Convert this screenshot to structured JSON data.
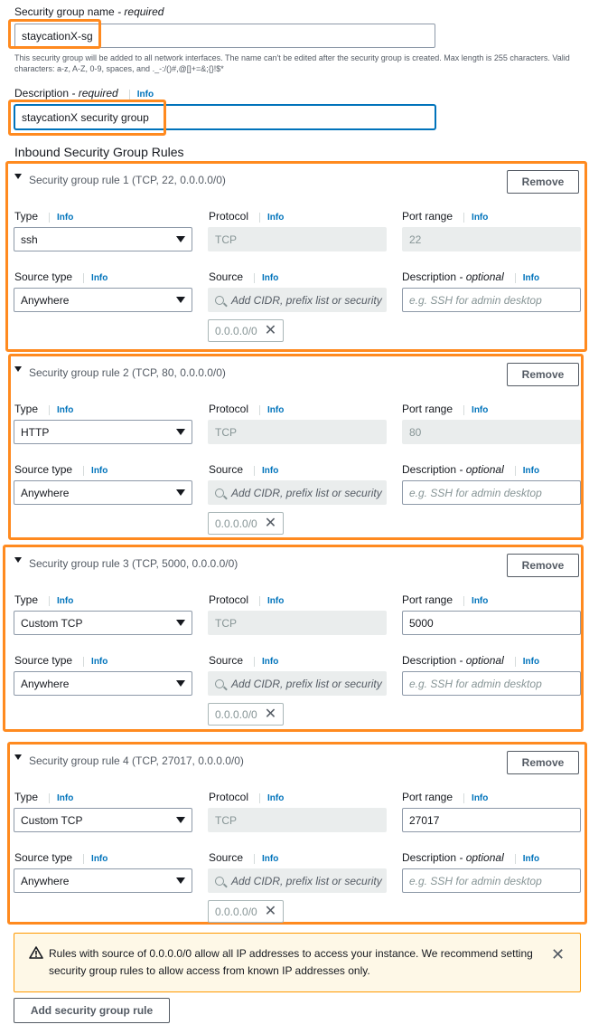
{
  "form": {
    "sg_name_label": "Security group name",
    "sg_name_required": " - required",
    "sg_name_value": "staycationX-sg",
    "sg_name_hint": "This security group will be added to all network interfaces. The name can't be edited after the security group is created. Max length is 255 characters. Valid characters: a-z, A-Z, 0-9, spaces, and ._-:/()#,@[]+=&;{}!$*",
    "desc_label": "Description",
    "desc_required": " - required",
    "desc_info": "Info",
    "desc_value": "staycationX security group",
    "inbound_title": "Inbound Security Group Rules"
  },
  "labels": {
    "type": "Type",
    "protocol": "Protocol",
    "port_range": "Port range",
    "source_type": "Source type",
    "source": "Source",
    "description": "Description",
    "optional": " - optional",
    "info": "Info",
    "remove": "Remove",
    "source_placeholder": "Add CIDR, prefix list or security",
    "desc_placeholder": "e.g. SSH for admin desktop"
  },
  "rules": [
    {
      "title": "Security group rule 1 (TCP, 22, 0.0.0.0/0)",
      "type": "ssh",
      "protocol": "TCP",
      "port": "22",
      "source_type": "Anywhere",
      "token": "0.0.0.0/0"
    },
    {
      "title": "Security group rule 2 (TCP, 80, 0.0.0.0/0)",
      "type": "HTTP",
      "protocol": "TCP",
      "port": "80",
      "source_type": "Anywhere",
      "token": "0.0.0.0/0"
    },
    {
      "title": "Security group rule 3 (TCP, 5000, 0.0.0.0/0)",
      "type": "Custom TCP",
      "protocol": "TCP",
      "port": "5000",
      "source_type": "Anywhere",
      "token": "0.0.0.0/0"
    },
    {
      "title": "Security group rule 4 (TCP, 27017, 0.0.0.0/0)",
      "type": "Custom TCP",
      "protocol": "TCP",
      "port": "27017",
      "source_type": "Anywhere",
      "token": "0.0.0.0/0"
    }
  ],
  "warning": {
    "text": "Rules with source of 0.0.0.0/0 allow all IP addresses to access your instance. We recommend setting security group rules to allow access from known IP addresses only."
  },
  "add_rule_label": "Add security group rule",
  "colors": {
    "highlight": "#ff8a1f",
    "info_link": "#0073bb",
    "warning_bg": "#fef8e7"
  }
}
